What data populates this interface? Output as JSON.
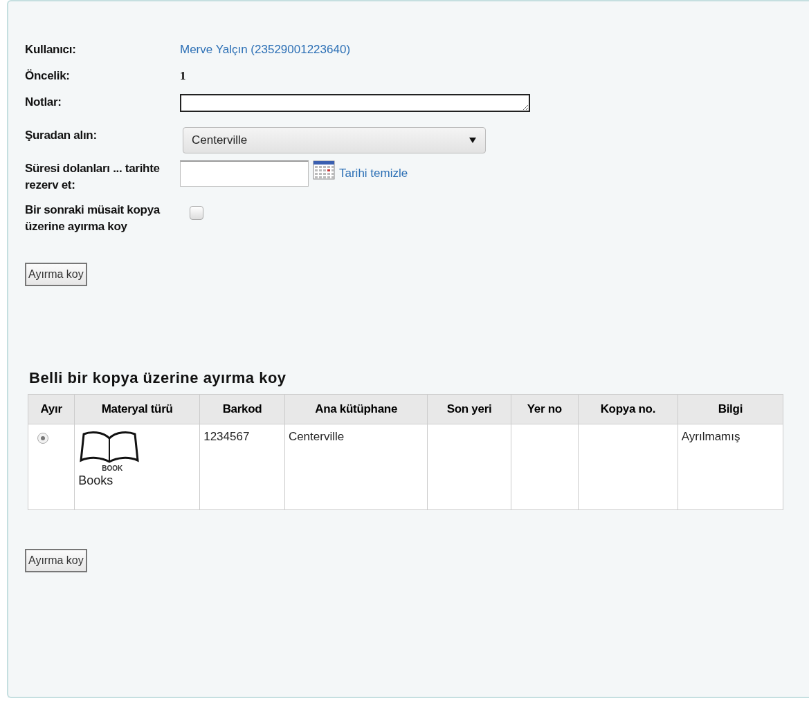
{
  "form": {
    "fields": [
      {
        "kind": "link",
        "label": "Kullanıcı:",
        "value": "Merve Yalçın (23529001223640)"
      },
      {
        "kind": "text",
        "label": "Öncelik:",
        "value": "1"
      },
      {
        "kind": "textarea",
        "label": "Notlar:"
      },
      {
        "kind": "select",
        "label": "Şuradan alın:",
        "value": "Centerville"
      },
      {
        "kind": "date",
        "label": "Süresi dolanları ... tarihte rezerv et:",
        "link": "Tarihi temizle"
      },
      {
        "kind": "checkbox",
        "label": "Bir sonraki müsait kopya üzerine ayırma koy",
        "checked": false
      }
    ],
    "submit": "Ayırma koy"
  },
  "specific": {
    "heading": "Belli bir kopya üzerine ayırma koy",
    "columns": [
      "Ayır",
      "Materyal türü",
      "Barkod",
      "Ana kütüphane",
      "Son yeri",
      "Yer no",
      "Kopya no.",
      "Bilgi"
    ],
    "rows": [
      {
        "selected": true,
        "icon_caption": "BOOK",
        "material": "Books",
        "barcode": "1234567",
        "library": "Centerville",
        "status": "Ayrılmamış"
      }
    ],
    "submit": "Ayırma koy"
  }
}
